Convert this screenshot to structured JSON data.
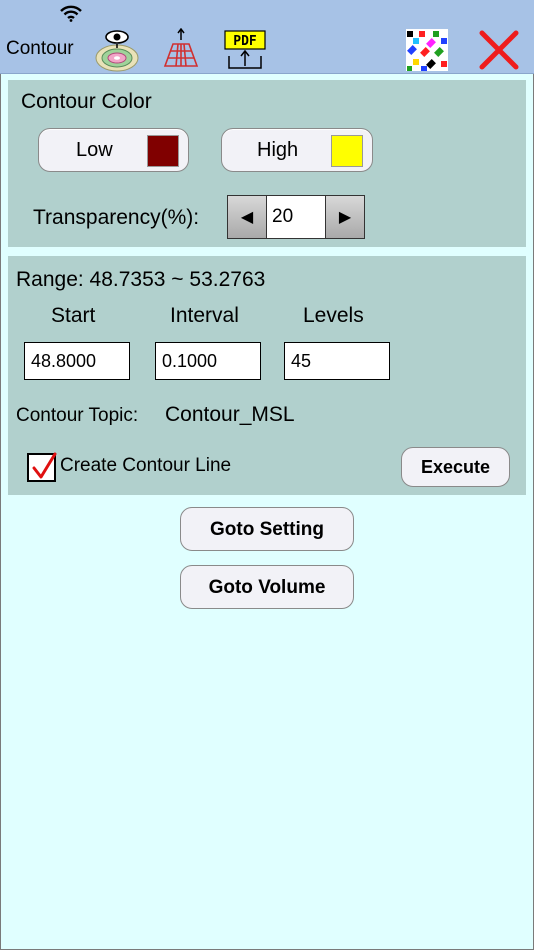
{
  "toolbar": {
    "title": "Contour",
    "icons": [
      "contour-map-icon",
      "grid-surface-icon",
      "pdf-export-icon",
      "color-palette-icon",
      "close-icon"
    ],
    "pdf_label": "PDF"
  },
  "color_panel": {
    "heading": "Contour Color",
    "low_label": "Low",
    "low_color": "#800000",
    "high_label": "High",
    "high_color": "#ffff00",
    "transparency_label": "Transparency(%):",
    "transparency_value": "20"
  },
  "range_panel": {
    "range_text": "Range: 48.7353 ~ 53.2763",
    "start_label": "Start",
    "interval_label": "Interval",
    "levels_label": "Levels",
    "start_value": "48.8000",
    "interval_value": "0.1000",
    "levels_value": "45",
    "topic_label": "Contour Topic:",
    "topic_value": "Contour_MSL",
    "create_line_label": "Create Contour Line",
    "create_line_checked": true,
    "execute_label": "Execute"
  },
  "actions": {
    "goto_setting_label": "Goto Setting",
    "goto_volume_label": "Goto Volume"
  }
}
